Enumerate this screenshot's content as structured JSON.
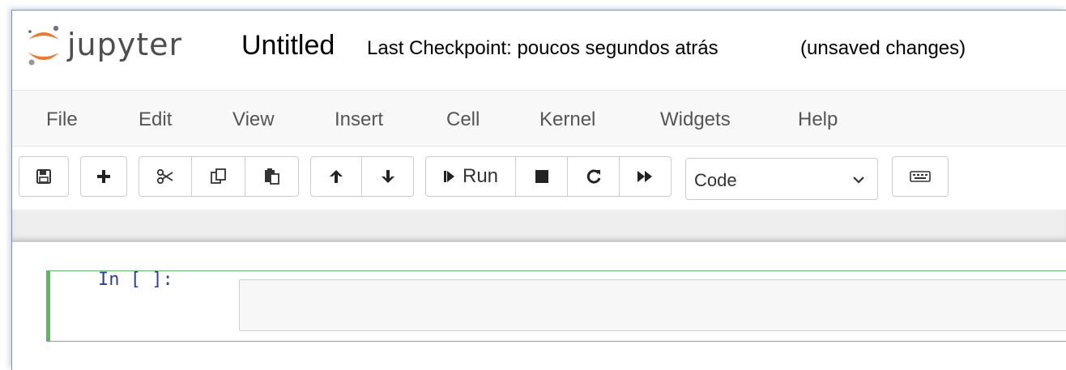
{
  "header": {
    "brand": "jupyter",
    "notebook_name": "Untitled",
    "checkpoint": "Last Checkpoint: poucos segundos atrás",
    "autosave_status": "(unsaved changes)"
  },
  "menubar": {
    "items": [
      "File",
      "Edit",
      "View",
      "Insert",
      "Cell",
      "Kernel",
      "Widgets",
      "Help"
    ]
  },
  "toolbar": {
    "buttons": [
      {
        "name": "save-button",
        "icon": "save-icon"
      },
      {
        "name": "insert-cell-below-button",
        "icon": "plus-icon"
      },
      {
        "name": "cut-button",
        "icon": "scissors-icon"
      },
      {
        "name": "copy-button",
        "icon": "copy-icon"
      },
      {
        "name": "paste-button",
        "icon": "paste-icon"
      },
      {
        "name": "move-up-button",
        "icon": "arrow-up-icon"
      },
      {
        "name": "move-down-button",
        "icon": "arrow-down-icon"
      },
      {
        "name": "run-button",
        "icon": "step-forward-icon"
      },
      {
        "name": "interrupt-button",
        "icon": "stop-icon"
      },
      {
        "name": "restart-button",
        "icon": "refresh-icon"
      },
      {
        "name": "restart-run-all-button",
        "icon": "fast-forward-icon"
      },
      {
        "name": "command-palette-button",
        "icon": "keyboard-icon"
      }
    ],
    "run_label": "Run",
    "cell_type": "Code"
  },
  "notebook": {
    "cells": [
      {
        "prompt": "In [ ]:",
        "source": ""
      }
    ]
  },
  "colors": {
    "logo_orange": "#f37726",
    "logo_gray": "#767677",
    "cell_selected_border": "#5cb85c",
    "prompt_color": "#303f9f"
  }
}
